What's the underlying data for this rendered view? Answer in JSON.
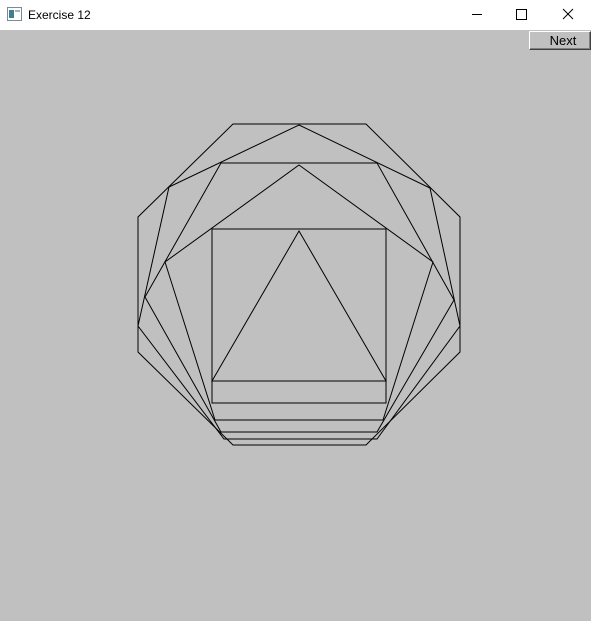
{
  "window": {
    "title": "Exercise 12"
  },
  "toolbar": {
    "next_label": "Next"
  },
  "colors": {
    "background": "#c0c0c0",
    "stroke": "#000000"
  },
  "drawing": {
    "description_shapes": [
      "octagon",
      "heptagon",
      "hexagon",
      "pentagon",
      "square",
      "triangle"
    ]
  }
}
